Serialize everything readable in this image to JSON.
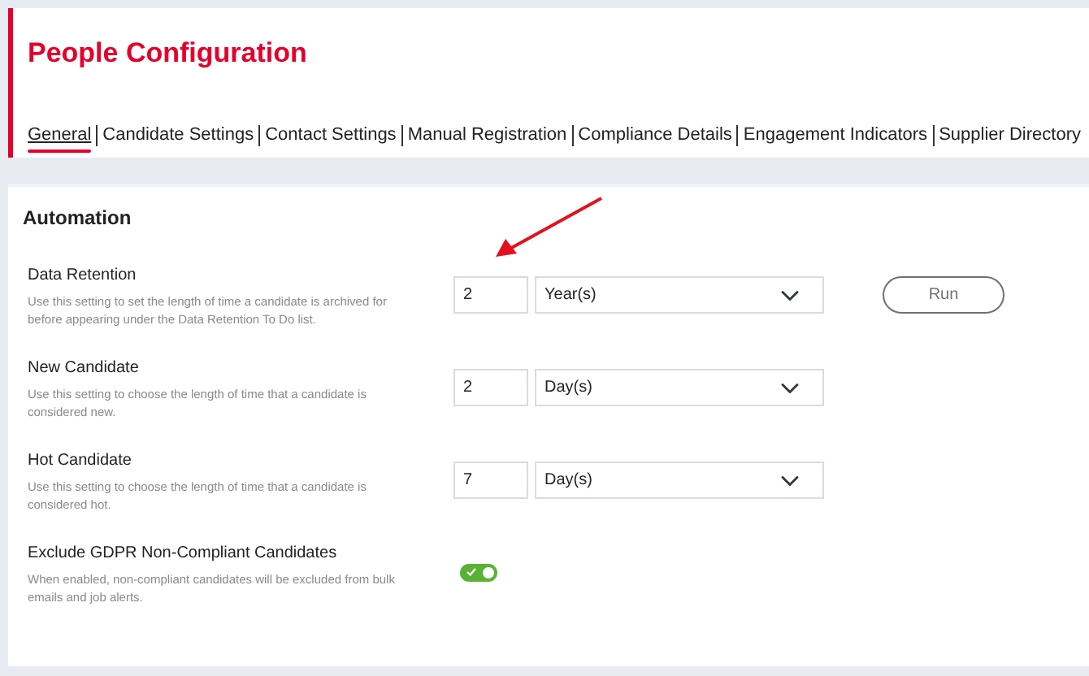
{
  "header": {
    "title": "People Configuration"
  },
  "tabs": [
    {
      "label": "General",
      "selected": true
    },
    {
      "label": "Candidate Settings",
      "selected": false
    },
    {
      "label": "Contact Settings",
      "selected": false
    },
    {
      "label": "Manual Registration",
      "selected": false
    },
    {
      "label": "Compliance Details",
      "selected": false
    },
    {
      "label": "Engagement Indicators",
      "selected": false
    },
    {
      "label": "Supplier Directory",
      "selected": false
    }
  ],
  "section": {
    "title": "Automation",
    "settings": [
      {
        "kind": "duration",
        "label": "Data Retention",
        "description": "Use this setting to set the length of time a candidate is archived for before appearing under the Data Retention To Do list.",
        "amount": "2",
        "unit": "Year(s)",
        "action": {
          "label": "Run",
          "disabled": true
        }
      },
      {
        "kind": "duration",
        "label": "New Candidate",
        "description": "Use this setting to choose the length of time that a candidate is considered new.",
        "amount": "2",
        "unit": "Day(s)"
      },
      {
        "kind": "duration",
        "label": "Hot Candidate",
        "description": "Use this setting to choose the length of time that a candidate is considered hot.",
        "amount": "7",
        "unit": "Day(s)"
      },
      {
        "kind": "toggle",
        "label": "Exclude GDPR Non-Compliant Candidates",
        "description": "When enabled, non-compliant candidates will be excluded from bulk emails and job alerts.",
        "on": true
      }
    ]
  }
}
